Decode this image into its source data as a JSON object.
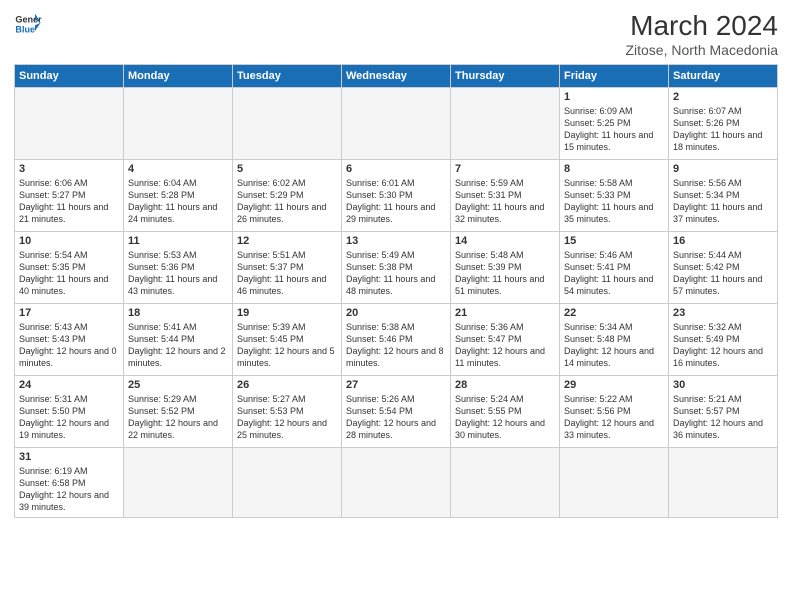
{
  "header": {
    "logo_general": "General",
    "logo_blue": "Blue",
    "title": "March 2024",
    "subtitle": "Zitose, North Macedonia"
  },
  "weekdays": [
    "Sunday",
    "Monday",
    "Tuesday",
    "Wednesday",
    "Thursday",
    "Friday",
    "Saturday"
  ],
  "weeks": [
    [
      {
        "day": "",
        "info": ""
      },
      {
        "day": "",
        "info": ""
      },
      {
        "day": "",
        "info": ""
      },
      {
        "day": "",
        "info": ""
      },
      {
        "day": "",
        "info": ""
      },
      {
        "day": "1",
        "info": "Sunrise: 6:09 AM\nSunset: 5:25 PM\nDaylight: 11 hours and 15 minutes."
      },
      {
        "day": "2",
        "info": "Sunrise: 6:07 AM\nSunset: 5:26 PM\nDaylight: 11 hours and 18 minutes."
      }
    ],
    [
      {
        "day": "3",
        "info": "Sunrise: 6:06 AM\nSunset: 5:27 PM\nDaylight: 11 hours and 21 minutes."
      },
      {
        "day": "4",
        "info": "Sunrise: 6:04 AM\nSunset: 5:28 PM\nDaylight: 11 hours and 24 minutes."
      },
      {
        "day": "5",
        "info": "Sunrise: 6:02 AM\nSunset: 5:29 PM\nDaylight: 11 hours and 26 minutes."
      },
      {
        "day": "6",
        "info": "Sunrise: 6:01 AM\nSunset: 5:30 PM\nDaylight: 11 hours and 29 minutes."
      },
      {
        "day": "7",
        "info": "Sunrise: 5:59 AM\nSunset: 5:31 PM\nDaylight: 11 hours and 32 minutes."
      },
      {
        "day": "8",
        "info": "Sunrise: 5:58 AM\nSunset: 5:33 PM\nDaylight: 11 hours and 35 minutes."
      },
      {
        "day": "9",
        "info": "Sunrise: 5:56 AM\nSunset: 5:34 PM\nDaylight: 11 hours and 37 minutes."
      }
    ],
    [
      {
        "day": "10",
        "info": "Sunrise: 5:54 AM\nSunset: 5:35 PM\nDaylight: 11 hours and 40 minutes."
      },
      {
        "day": "11",
        "info": "Sunrise: 5:53 AM\nSunset: 5:36 PM\nDaylight: 11 hours and 43 minutes."
      },
      {
        "day": "12",
        "info": "Sunrise: 5:51 AM\nSunset: 5:37 PM\nDaylight: 11 hours and 46 minutes."
      },
      {
        "day": "13",
        "info": "Sunrise: 5:49 AM\nSunset: 5:38 PM\nDaylight: 11 hours and 48 minutes."
      },
      {
        "day": "14",
        "info": "Sunrise: 5:48 AM\nSunset: 5:39 PM\nDaylight: 11 hours and 51 minutes."
      },
      {
        "day": "15",
        "info": "Sunrise: 5:46 AM\nSunset: 5:41 PM\nDaylight: 11 hours and 54 minutes."
      },
      {
        "day": "16",
        "info": "Sunrise: 5:44 AM\nSunset: 5:42 PM\nDaylight: 11 hours and 57 minutes."
      }
    ],
    [
      {
        "day": "17",
        "info": "Sunrise: 5:43 AM\nSunset: 5:43 PM\nDaylight: 12 hours and 0 minutes."
      },
      {
        "day": "18",
        "info": "Sunrise: 5:41 AM\nSunset: 5:44 PM\nDaylight: 12 hours and 2 minutes."
      },
      {
        "day": "19",
        "info": "Sunrise: 5:39 AM\nSunset: 5:45 PM\nDaylight: 12 hours and 5 minutes."
      },
      {
        "day": "20",
        "info": "Sunrise: 5:38 AM\nSunset: 5:46 PM\nDaylight: 12 hours and 8 minutes."
      },
      {
        "day": "21",
        "info": "Sunrise: 5:36 AM\nSunset: 5:47 PM\nDaylight: 12 hours and 11 minutes."
      },
      {
        "day": "22",
        "info": "Sunrise: 5:34 AM\nSunset: 5:48 PM\nDaylight: 12 hours and 14 minutes."
      },
      {
        "day": "23",
        "info": "Sunrise: 5:32 AM\nSunset: 5:49 PM\nDaylight: 12 hours and 16 minutes."
      }
    ],
    [
      {
        "day": "24",
        "info": "Sunrise: 5:31 AM\nSunset: 5:50 PM\nDaylight: 12 hours and 19 minutes."
      },
      {
        "day": "25",
        "info": "Sunrise: 5:29 AM\nSunset: 5:52 PM\nDaylight: 12 hours and 22 minutes."
      },
      {
        "day": "26",
        "info": "Sunrise: 5:27 AM\nSunset: 5:53 PM\nDaylight: 12 hours and 25 minutes."
      },
      {
        "day": "27",
        "info": "Sunrise: 5:26 AM\nSunset: 5:54 PM\nDaylight: 12 hours and 28 minutes."
      },
      {
        "day": "28",
        "info": "Sunrise: 5:24 AM\nSunset: 5:55 PM\nDaylight: 12 hours and 30 minutes."
      },
      {
        "day": "29",
        "info": "Sunrise: 5:22 AM\nSunset: 5:56 PM\nDaylight: 12 hours and 33 minutes."
      },
      {
        "day": "30",
        "info": "Sunrise: 5:21 AM\nSunset: 5:57 PM\nDaylight: 12 hours and 36 minutes."
      }
    ],
    [
      {
        "day": "31",
        "info": "Sunrise: 6:19 AM\nSunset: 6:58 PM\nDaylight: 12 hours and 39 minutes."
      },
      {
        "day": "",
        "info": ""
      },
      {
        "day": "",
        "info": ""
      },
      {
        "day": "",
        "info": ""
      },
      {
        "day": "",
        "info": ""
      },
      {
        "day": "",
        "info": ""
      },
      {
        "day": "",
        "info": ""
      }
    ]
  ]
}
